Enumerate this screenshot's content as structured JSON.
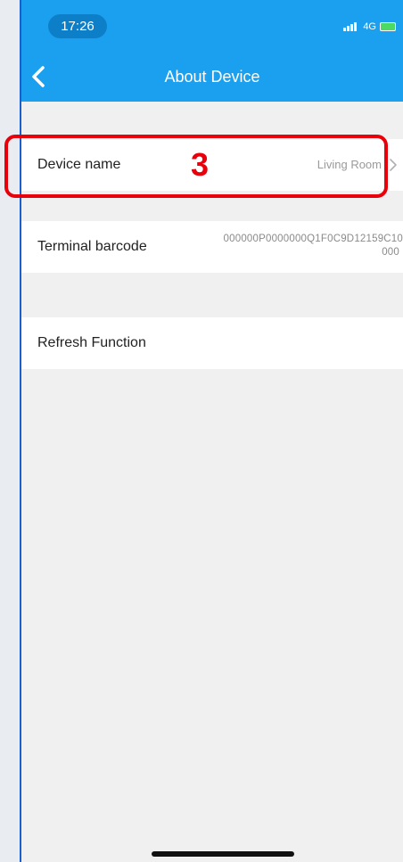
{
  "status_bar": {
    "time": "17:26",
    "network": "4G"
  },
  "nav": {
    "title": "About Device",
    "back_icon": "chevron-left-icon"
  },
  "rows": {
    "device_name": {
      "label": "Device name",
      "value": "Living Room",
      "icon": "chevron-right-icon"
    },
    "terminal_barcode": {
      "label": "Terminal barcode",
      "value_line1": "000000P0000000Q1F0C9D12159C10",
      "value_line2": "000"
    },
    "refresh_function": {
      "label": "Refresh Function"
    }
  },
  "annotation": {
    "number": "3",
    "color": "#e8000a"
  },
  "colors": {
    "header": "#1aa0ee",
    "background": "#f0f0f0"
  }
}
